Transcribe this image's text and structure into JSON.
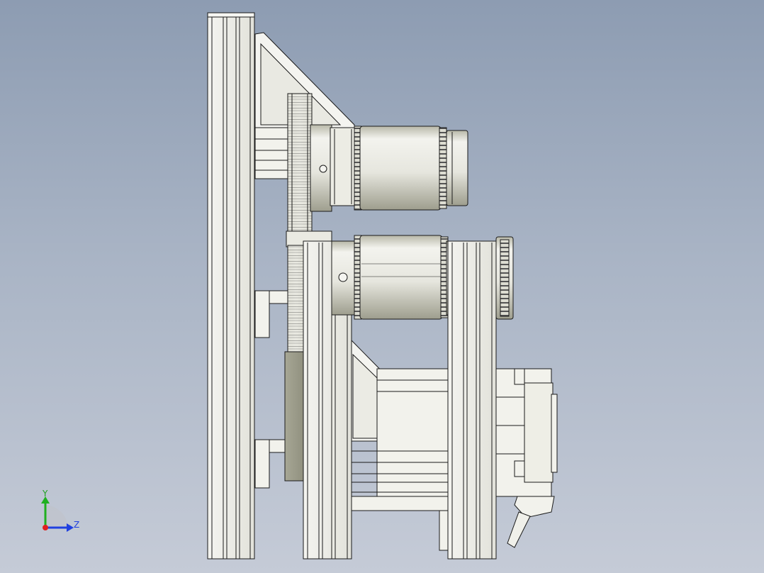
{
  "viewport": {
    "background_top": "#8d9cb2",
    "background_bottom": "#c5cbd7"
  },
  "colors": {
    "part_light": "#f2f2ee",
    "part_shade": "#d4d4c8",
    "part_dark": "#a9a999",
    "edge": "#1a1a1a",
    "axis_x": "#e02020",
    "axis_y": "#20b020",
    "axis_z": "#2040e0"
  },
  "triad": {
    "y_label": "Y",
    "z_label": "Z"
  },
  "parts": {
    "main_profile": "aluminum-extrusion-profile-vertical",
    "upper_gear": "spur-gear",
    "upper_roller": "timing-pulley-roller",
    "lower_roller": "timing-pulley-roller",
    "motor": "stepper-motor",
    "gusset": "triangular-gusset-bracket"
  }
}
